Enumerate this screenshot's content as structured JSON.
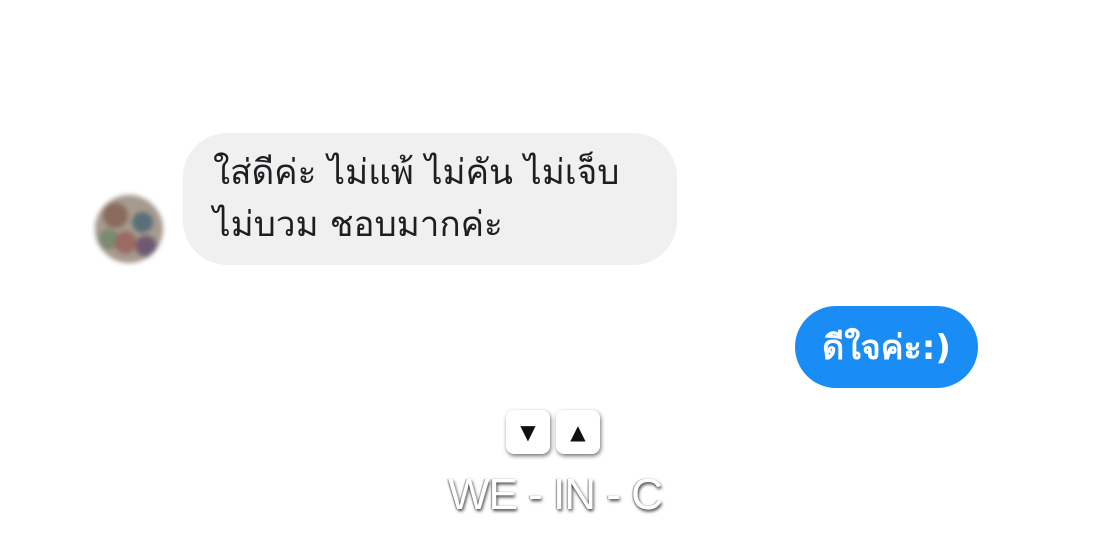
{
  "conversation": {
    "incoming_message": {
      "lines": [
        "ใส่ดีค่ะ ไม่แพ้ ไม่คัน ไม่เจ็บ",
        "ไม่บวม ชอบมากค่ะ"
      ]
    },
    "outgoing_message": {
      "text": "ดีใจค่ะ:)"
    }
  },
  "watermark": {
    "text": "WE - IN - C",
    "marks": [
      "▼",
      "▲"
    ],
    "icons": [
      "down-triangle-icon",
      "up-triangle-icon"
    ]
  },
  "colors": {
    "incoming_bubble": "#f0f0f0",
    "outgoing_bubble": "#1a8cf5",
    "incoming_text": "#1c1e21",
    "outgoing_text": "#ffffff"
  }
}
